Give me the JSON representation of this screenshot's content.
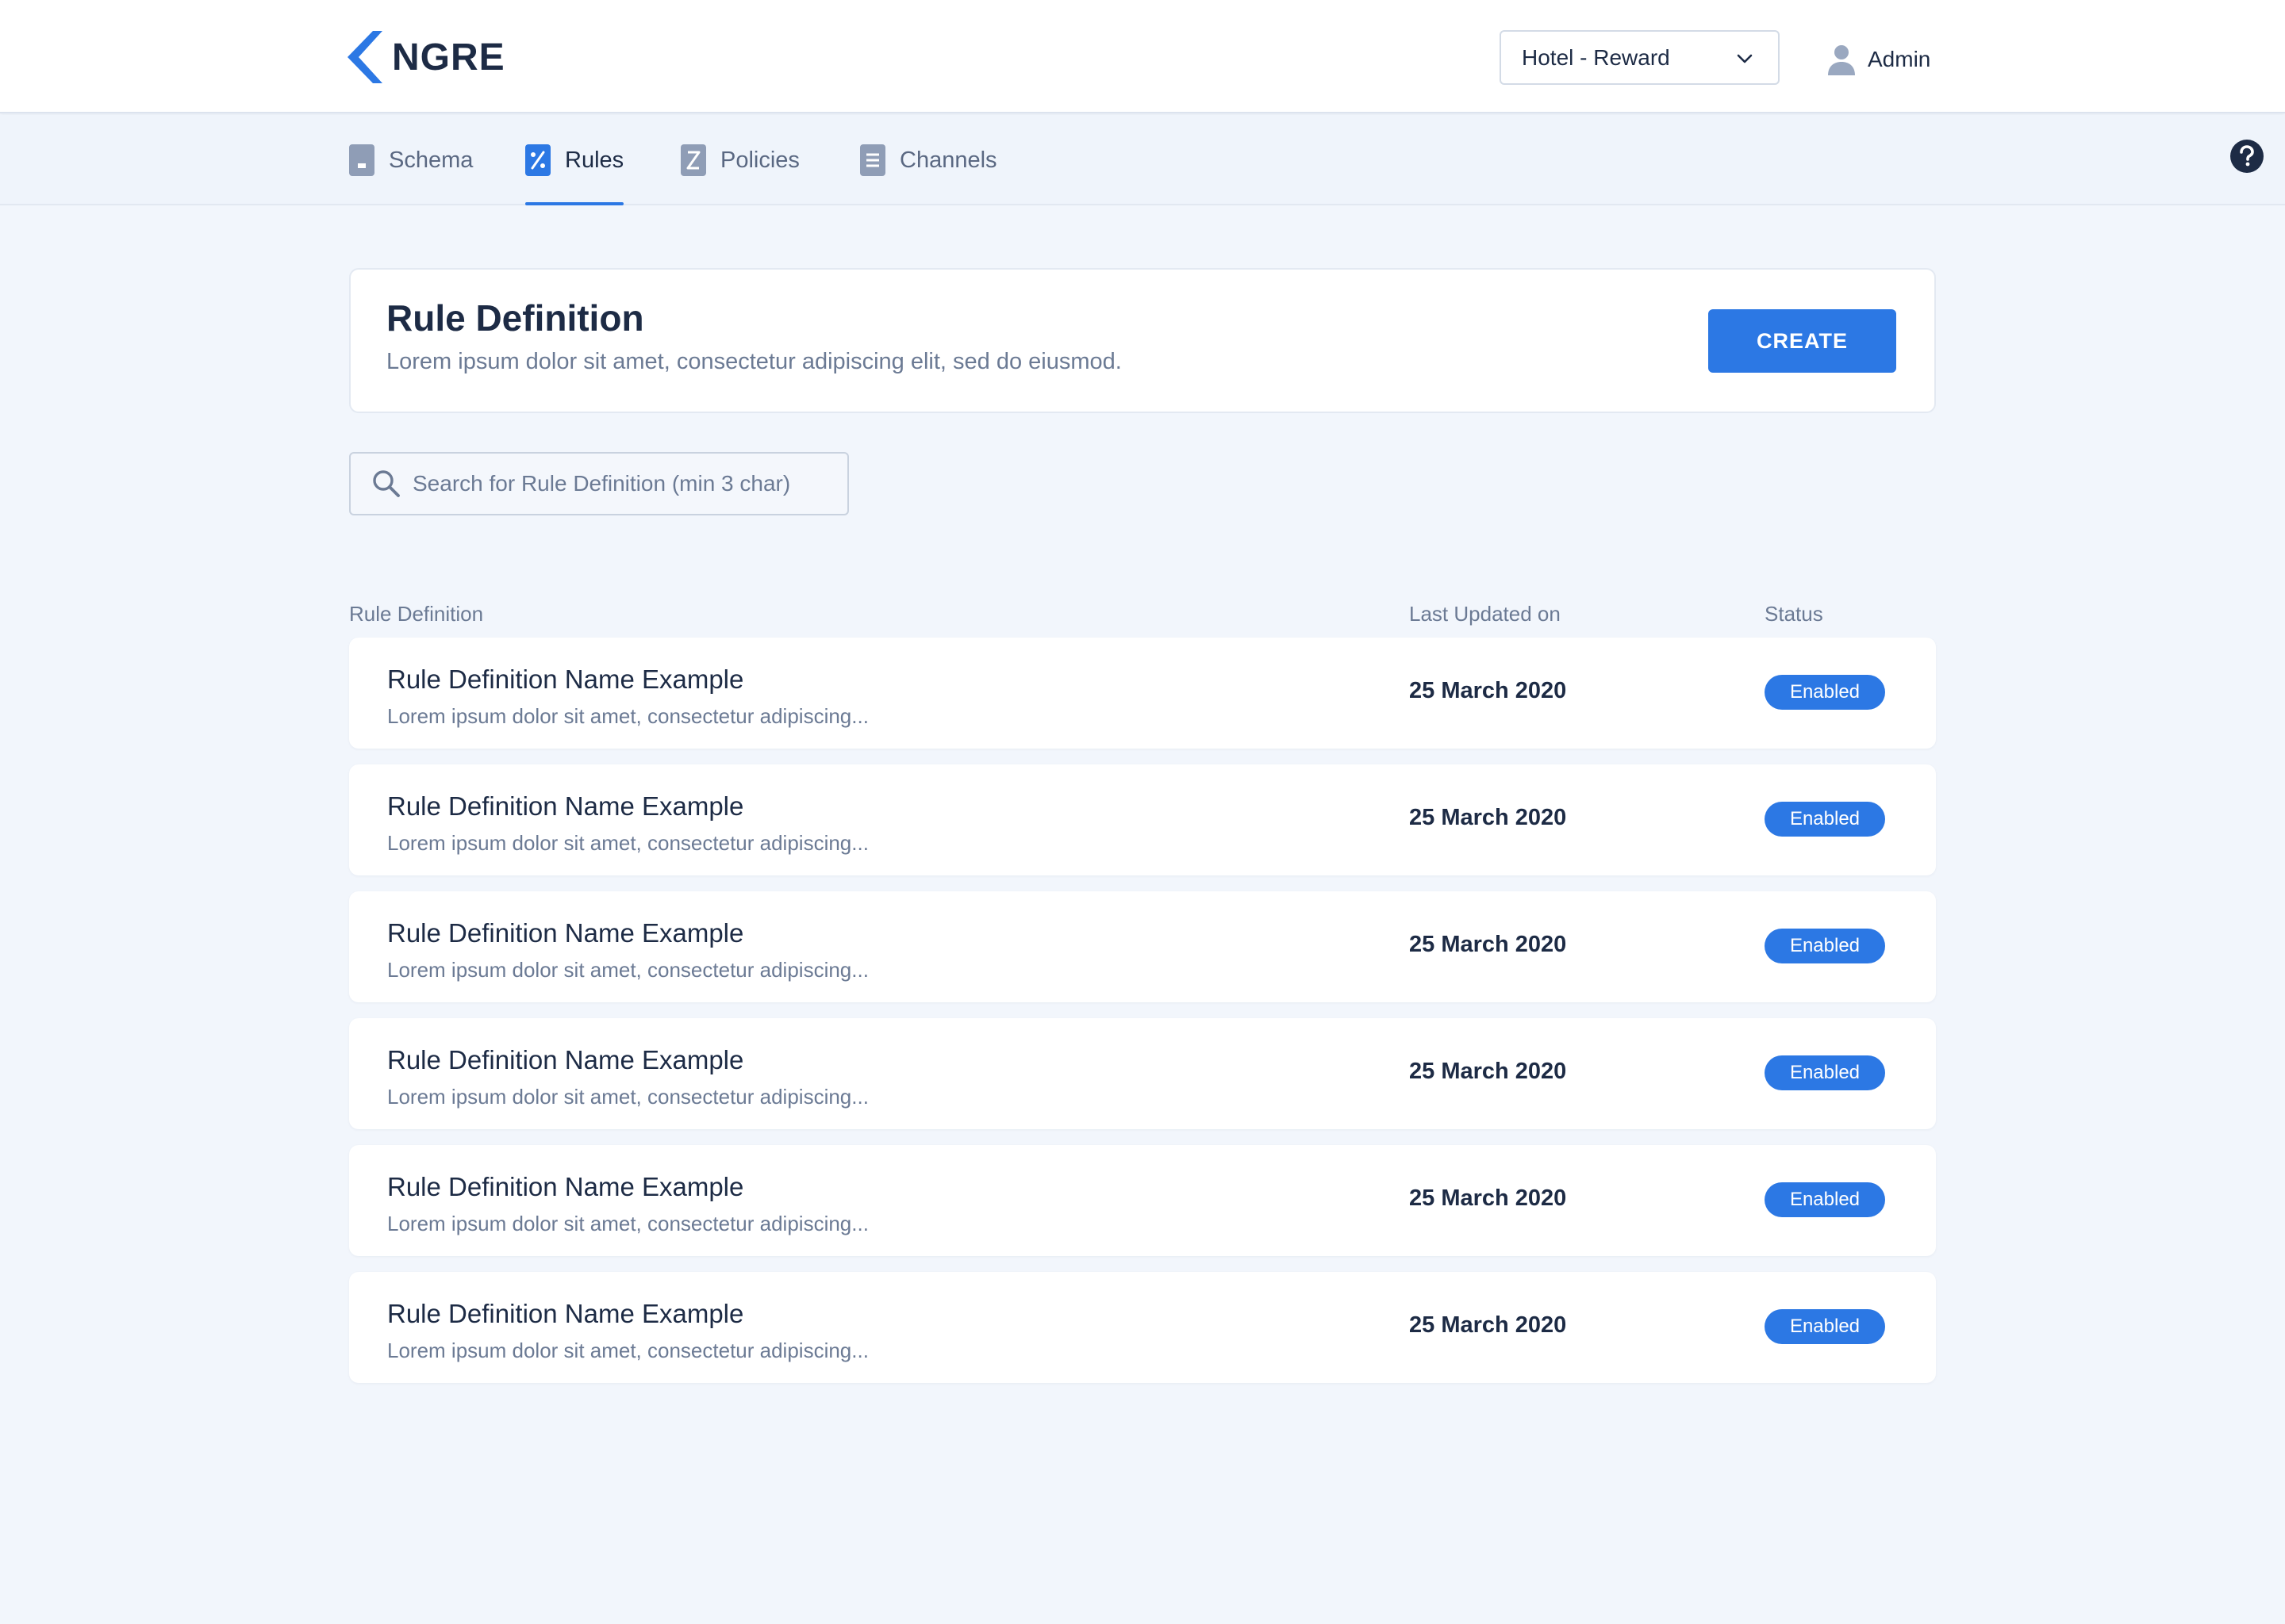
{
  "header": {
    "logo_text": "NGRE",
    "selector_value": "Hotel - Reward",
    "user_name": "Admin"
  },
  "tabs": [
    {
      "label": "Schema",
      "icon": "schema-icon"
    },
    {
      "label": "Rules",
      "icon": "rules-percent-icon",
      "active": true
    },
    {
      "label": "Policies",
      "icon": "policies-icon"
    },
    {
      "label": "Channels",
      "icon": "channels-icon"
    }
  ],
  "definition": {
    "title": "Rule Definition",
    "subtitle": "Lorem ipsum dolor sit amet, consectetur adipiscing elit, sed do eiusmod.",
    "create_label": "CREATE"
  },
  "search": {
    "placeholder": "Search for Rule Definition (min 3 char)"
  },
  "table": {
    "columns": [
      "Rule Definition",
      "Last Updated on",
      "Status"
    ],
    "rows": [
      {
        "name": "Rule Definition Name Example",
        "description": "Lorem ipsum dolor sit amet, consectetur adipiscing...",
        "date": "25 March 2020",
        "status": "Enabled"
      },
      {
        "name": "Rule Definition Name Example",
        "description": "Lorem ipsum dolor sit amet, consectetur adipiscing...",
        "date": "25 March 2020",
        "status": "Enabled"
      },
      {
        "name": "Rule Definition Name Example",
        "description": "Lorem ipsum dolor sit amet, consectetur adipiscing...",
        "date": "25 March 2020",
        "status": "Enabled"
      },
      {
        "name": "Rule Definition Name Example",
        "description": "Lorem ipsum dolor sit amet, consectetur adipiscing...",
        "date": "25 March 2020",
        "status": "Enabled"
      },
      {
        "name": "Rule Definition Name Example",
        "description": "Lorem ipsum dolor sit amet, consectetur adipiscing...",
        "date": "25 March 2020",
        "status": "Enabled"
      },
      {
        "name": "Rule Definition Name Example",
        "description": "Lorem ipsum dolor sit amet, consectetur adipiscing...",
        "date": "25 March 2020",
        "status": "Enabled"
      }
    ]
  },
  "colors": {
    "accent": "#2C78E4",
    "text_primary": "#1D2B45",
    "text_muted": "#6B7A94",
    "background": "#F2F6FC"
  }
}
